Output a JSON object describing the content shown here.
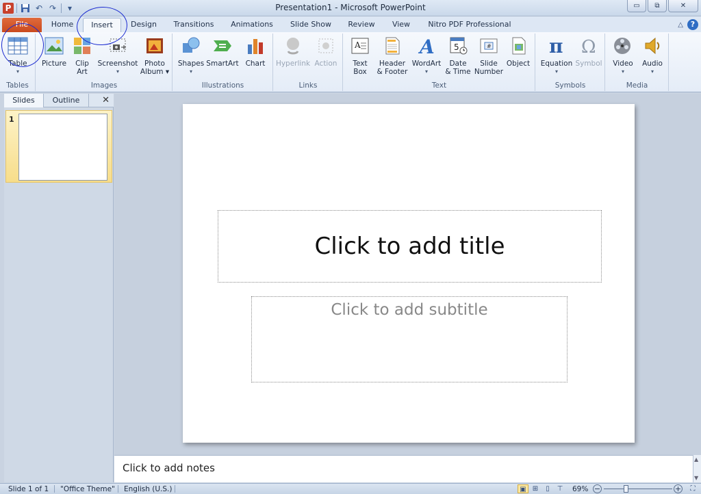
{
  "window": {
    "title": "Presentation1  -  Microsoft PowerPoint",
    "app_badge": "P",
    "minimize_glyph": "▭",
    "restore_glyph": "⧉",
    "close_glyph": "✕"
  },
  "qat": {
    "save_icon": "save-icon",
    "undo_glyph": "↶",
    "redo_glyph": "↷",
    "customize_glyph": "▾"
  },
  "tabs": [
    "File",
    "Home",
    "Insert",
    "Design",
    "Transitions",
    "Animations",
    "Slide Show",
    "Review",
    "View",
    "Nitro PDF Professional"
  ],
  "active_tab": "Insert",
  "help": {
    "glyph": "?",
    "collapse_glyph": "△"
  },
  "ribbon": {
    "groups": {
      "tables": "Tables",
      "images": "Images",
      "illustrations": "Illustrations",
      "links": "Links",
      "text": "Text",
      "symbols": "Symbols",
      "media": "Media"
    },
    "buttons": {
      "table": {
        "label": "Table",
        "dd": "▾"
      },
      "picture": {
        "label": "Picture"
      },
      "clip_art": {
        "label": "Clip",
        "label2": "Art"
      },
      "screenshot": {
        "label": "Screenshot",
        "dd": "▾"
      },
      "photo_album": {
        "label": "Photo",
        "label2": "Album ▾"
      },
      "shapes": {
        "label": "Shapes",
        "dd": "▾"
      },
      "smartart": {
        "label": "SmartArt"
      },
      "chart": {
        "label": "Chart"
      },
      "hyperlink": {
        "label": "Hyperlink"
      },
      "action": {
        "label": "Action"
      },
      "text_box": {
        "label": "Text",
        "label2": "Box"
      },
      "header_footer": {
        "label": "Header",
        "label2": "& Footer"
      },
      "wordart": {
        "label": "WordArt",
        "dd": "▾"
      },
      "date_time": {
        "label": "Date",
        "label2": "& Time"
      },
      "slide_number": {
        "label": "Slide",
        "label2": "Number"
      },
      "object": {
        "label": "Object"
      },
      "equation": {
        "label": "Equation",
        "dd": "▾"
      },
      "symbol": {
        "label": "Symbol"
      },
      "video": {
        "label": "Video",
        "dd": "▾"
      },
      "audio": {
        "label": "Audio",
        "dd": "▾"
      }
    }
  },
  "left_panel": {
    "tabs": [
      "Slides",
      "Outline"
    ],
    "close_glyph": "✕",
    "slide_number": "1"
  },
  "slide": {
    "title_placeholder": "Click to add title",
    "subtitle_placeholder": "Click to add subtitle"
  },
  "notes": {
    "placeholder": "Click to add notes"
  },
  "statusbar": {
    "slide_info": "Slide 1 of 1",
    "theme": "\"Office Theme\"",
    "language": "English (U.S.)",
    "zoom": "69%",
    "zoom_minus": "−",
    "zoom_plus": "+",
    "zoom_level": 0.69
  },
  "colors": {
    "file_tab": "#c94a1e",
    "annotation": "#1a2ad0",
    "selected_thumb": "#f7dd8a"
  }
}
